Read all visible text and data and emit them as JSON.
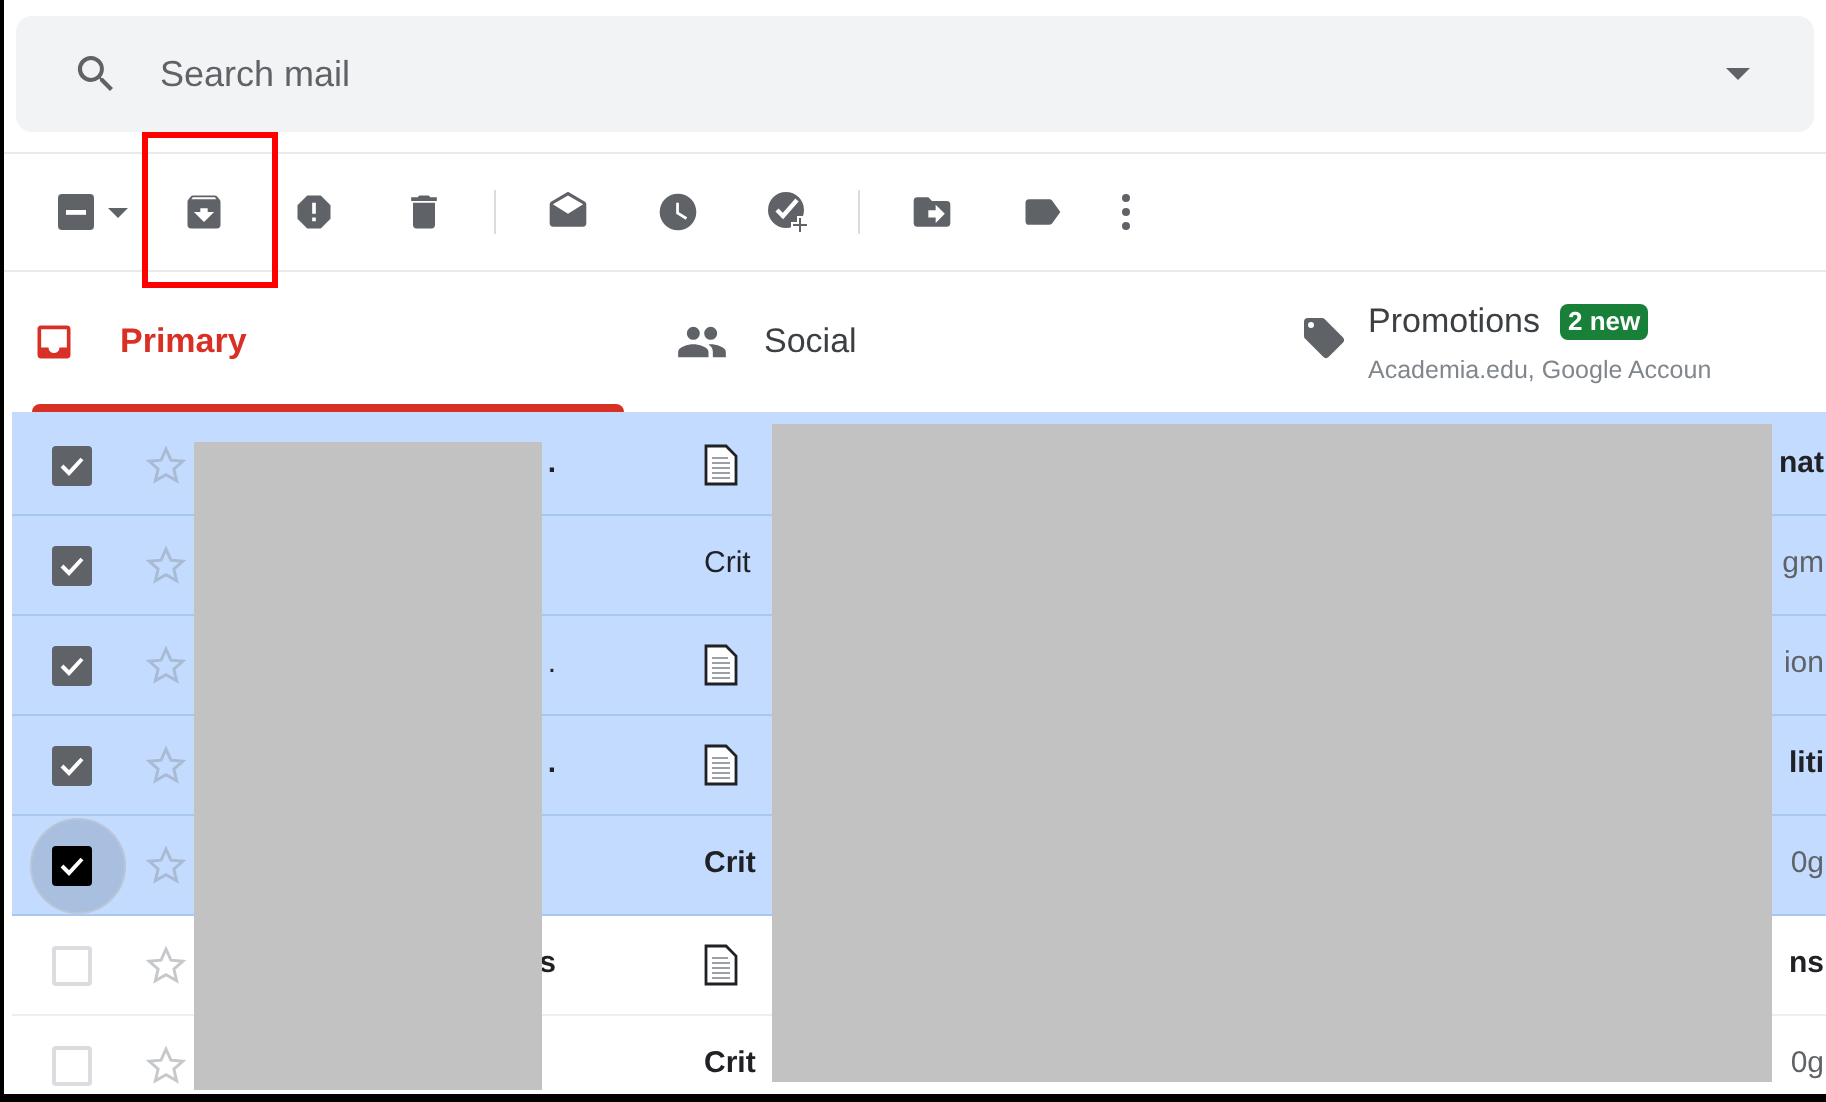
{
  "search": {
    "placeholder": "Search mail"
  },
  "toolbar": [
    {
      "kind": "select",
      "indeterminate": true
    },
    {
      "kind": "archive",
      "highlighted": true
    },
    {
      "kind": "spam"
    },
    {
      "kind": "delete"
    },
    {
      "kind": "divider"
    },
    {
      "kind": "read"
    },
    {
      "kind": "snooze"
    },
    {
      "kind": "task"
    },
    {
      "kind": "divider"
    },
    {
      "kind": "move"
    },
    {
      "kind": "label"
    },
    {
      "kind": "more"
    }
  ],
  "tabs": [
    {
      "kind": "primary",
      "label": "Primary",
      "selected": true
    },
    {
      "kind": "social",
      "label": "Social",
      "selected": false
    },
    {
      "kind": "promotions",
      "label": "Promotions",
      "selected": false,
      "badge": "2 new",
      "subtitle": "Academia.edu, Google Accoun"
    }
  ],
  "rows": [
    {
      "checked": true,
      "focused": false,
      "unread": true,
      "sender": ".",
      "attachment": true,
      "tail": "nat",
      "tail_muted": false
    },
    {
      "checked": true,
      "focused": false,
      "unread": false,
      "attachment": false,
      "subject": "Crit",
      "tail": "gm",
      "tail_muted": true
    },
    {
      "checked": true,
      "focused": false,
      "unread": false,
      "sender": ".",
      "attachment": true,
      "tail": "ion",
      "tail_muted": true
    },
    {
      "checked": true,
      "focused": false,
      "unread": true,
      "sender": ".",
      "attachment": true,
      "tail": "liti",
      "tail_muted": false
    },
    {
      "checked": true,
      "focused": true,
      "unread": true,
      "attachment": false,
      "subject": "Crit",
      "tail": "0g",
      "tail_muted": true
    },
    {
      "checked": false,
      "focused": false,
      "unread": true,
      "sender": "s",
      "attachment": true,
      "tail": "ns",
      "tail_muted": false
    },
    {
      "checked": false,
      "focused": false,
      "unread": true,
      "attachment": false,
      "subject": "Crit",
      "tail": "0g",
      "tail_muted": true
    }
  ]
}
